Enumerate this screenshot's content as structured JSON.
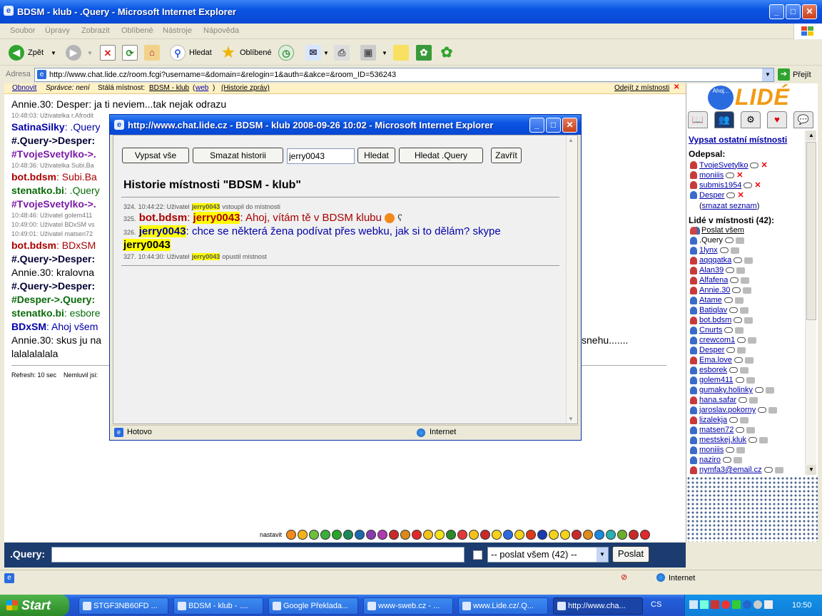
{
  "window": {
    "title": "BDSM - klub - .Query - Microsoft Internet Explorer",
    "menu": [
      "Soubor",
      "Úpravy",
      "Zobrazit",
      "Oblíbené",
      "Nástroje",
      "Nápověda"
    ],
    "toolbar": {
      "back": "Zpět",
      "search": "Hledat",
      "favorites": "Oblíbené"
    },
    "address_label": "Adresa",
    "url": "http://www.chat.lide.cz/room.fcgi?username=&domain=&relogin=1&auth=&akce=&room_ID=536243",
    "go": "Přejít"
  },
  "roombar": {
    "refresh": "Obnovit",
    "admin": "Správce: není",
    "permanent": "Stálá místnost:",
    "room_link": "BDSM - klub",
    "web_open": "(",
    "web": "web",
    "web_close": ")",
    "history": "(Historie zpráv)",
    "leave": "Odejít z místnosti"
  },
  "chat": [
    {
      "name": "Annie.30",
      "text": ": Desper: ja ti neviem...tak nejak odrazu"
    },
    {
      "sys": "10:48:03: Uživatelka r.Afrodit"
    },
    {
      "name": "SatinaSilky",
      "text": ": .Query"
    },
    {
      "name": "#.Query->Desper:",
      "text": ""
    },
    {
      "name": "#TvojeSvetylko->.",
      "text": ""
    },
    {
      "sys": "10:48:36: Uživatelka Subi.Ba"
    },
    {
      "name": "bot.bdsm",
      "text": ": Subi.Ba"
    },
    {
      "name": "stenatko.bi",
      "text": ": .Query"
    },
    {
      "name": "#TvojeSvetylko->.",
      "text": ""
    },
    {
      "sys": "10:48:46: Uživatel golem411"
    },
    {
      "sys": "10:49:00: Uživatel BDxSM vs"
    },
    {
      "sys": "10:49:01: Uživatel matsen72"
    },
    {
      "name": "bot.bdsm",
      "text": ": BDxSM"
    },
    {
      "name": "#.Query->Desper:",
      "text": ""
    },
    {
      "name": "Annie.30",
      "text": ": kralovna"
    },
    {
      "name": "#.Query->Desper:",
      "text": ""
    },
    {
      "name": "#Desper->.Query:",
      "text": ""
    },
    {
      "name": "stenatko.bi",
      "text": ": esbore"
    },
    {
      "name": "BDxSM",
      "text": ": Ahoj všem"
    },
    {
      "name": "Annie.30",
      "text": ": skus ju na",
      "tail": "snehu......."
    },
    {
      "plain": "lalalalalala"
    }
  ],
  "footer_info": {
    "refresh": "Refresh: 10 sec",
    "idle": "Nemluvil jsi:"
  },
  "smileys_label": "nastavit",
  "input": {
    "nick": ".Query:",
    "value": "",
    "recipient": "-- poslat všem (42) --",
    "send": "Poslat"
  },
  "sidebar": {
    "other_rooms": "Vypsat ostatní místnosti",
    "away_title": "Odepsal:",
    "away": [
      "TvojeSvetylko",
      "moniiis",
      "submis1954",
      "Desper"
    ],
    "clear_list": "smazat seznam",
    "clear_open": "(",
    "clear_close": ")",
    "people_title": "Lidé v místnosti (42):",
    "send_all": "Poslat všem",
    "people": [
      ".Query",
      "1lynx",
      "aqqqatka",
      "Alan39",
      "Alfafena",
      "Annie.30",
      "Atame",
      "Batiqlav",
      "bot.bdsm",
      "Cnurts",
      "crewcom1",
      "Desper",
      "Ema.love",
      "esborek",
      "golem411",
      "gumaky.holinky",
      "hana.safar",
      "jaroslav.pokorny",
      "lizalekja",
      "matsen72",
      "mestskej.kluk",
      "moniiis",
      "naziro",
      "nymfa3@email.cz"
    ],
    "logo": "LIDÉ",
    "logo_small": "Ahoj..."
  },
  "popup": {
    "title": "http://www.chat.lide.cz - BDSM - klub 2008-09-26 10:02 - Microsoft Internet Explorer",
    "btn_all": "Vypsat vše",
    "btn_clear": "Smazat historii",
    "search_value": "jerry0043",
    "btn_search": "Hledat",
    "btn_search_query": "Hledat .Query",
    "btn_close": "Zavřít",
    "heading": "Historie místnosti \"BDSM - klub\"",
    "entries": [
      {
        "num": "324.",
        "time": "10:44:22: Uživatel",
        "user": "jerry0043",
        "text": "vstoupil do místnosti"
      },
      {
        "num": "325.",
        "from": "bot.bdsm",
        "to": "jerry0043",
        "text": ": Ahoj, vítám tě v BDSM klubu"
      },
      {
        "num": "326.",
        "from": "jerry0043",
        "text": ": chce se některá žena podívat přes webku, jak si to dělám? skype",
        "tail": "jerry0043"
      },
      {
        "num": "327.",
        "time": "10:44:30: Uživatel",
        "user": "jerry0043",
        "text": "opustil místnost"
      }
    ],
    "status": "Hotovo",
    "zone": "Internet"
  },
  "status": {
    "zone": "Internet"
  },
  "taskbar": {
    "start": "Start",
    "tasks": [
      "STGF3NB60FD ...",
      "BDSM - klub - ....",
      "Google Překlada...",
      "www-sweb.cz - ...",
      "www.Lide.cz/.Q...",
      "http://www.cha..."
    ],
    "lang": "CS",
    "clock": "10:50"
  }
}
